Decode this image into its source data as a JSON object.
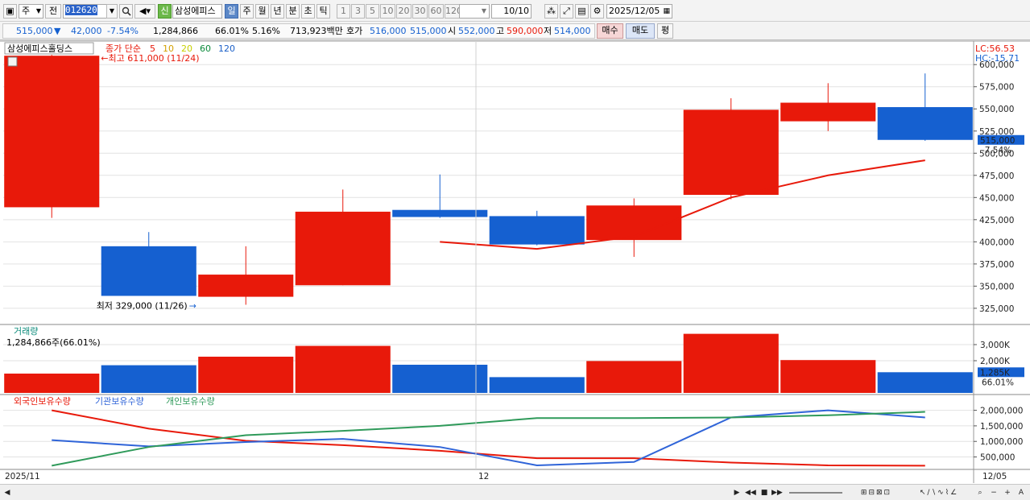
{
  "toolbar": {
    "period_select": "주",
    "prev_label": "전",
    "stock_code": "012620",
    "new_label": "신",
    "stock_name": "삼성에피스",
    "tf_tabs": [
      "일",
      "주",
      "월",
      "년",
      "분",
      "초",
      "틱"
    ],
    "tf_selected": "일",
    "intervals": [
      "1",
      "3",
      "5",
      "10",
      "20",
      "30",
      "60",
      "120"
    ],
    "count": "10",
    "count_total": "/10",
    "date": "2025/12/05"
  },
  "quote": {
    "price": "515,000",
    "change_arrow": "▼",
    "change": "42,000",
    "change_rate": "-7.54%",
    "volume": "1,284,866",
    "vol_ratio": "66.01%",
    "turnover": "5.16%",
    "amount": "713,923백만",
    "ask_label": "호가",
    "ask": "516,000",
    "bid": "515,000",
    "open_label": "시",
    "open": "552,000",
    "high_label": "고",
    "high": "590,000",
    "low_label": "저",
    "low": "514,000",
    "buy_label": "매수",
    "sell_label": "매도",
    "eval_label": "평"
  },
  "colors": {
    "up": "#e8190a",
    "down": "#1560d0",
    "ma5": "#e8190a",
    "ma10": "#d4a000",
    "ma20": "#c8d000",
    "ma60": "#0a8a3a",
    "ma120": "#1a5fc8",
    "foreign": "#e8190a",
    "inst": "#2f64d8",
    "indiv": "#2f9a5a"
  },
  "chart_data": {
    "type": "candlestick",
    "stock": "삼성에피스홀딩스",
    "legend": "종가 단순",
    "ma_periods": [
      "5",
      "10",
      "20",
      "60",
      "120"
    ],
    "lc_label": "LC:56.53",
    "hc_label": "HC:-15.71",
    "high_mark": "최고 611,000 (11/24)",
    "low_mark": "최저 329,000 (11/26)",
    "last_price_label": "515,000",
    "last_change_label": "-7.54%",
    "price_ticks": [
      "600,000",
      "575,000",
      "550,000",
      "525,000",
      "500,000",
      "475,000",
      "450,000",
      "425,000",
      "400,000",
      "375,000",
      "350,000",
      "325,000"
    ],
    "price_tick_values": [
      600000,
      575000,
      550000,
      525000,
      500000,
      475000,
      450000,
      425000,
      400000,
      375000,
      350000,
      325000
    ],
    "price_range": [
      314000,
      612000
    ],
    "candles": [
      {
        "o": 439000,
        "h": 611000,
        "l": 427000,
        "c": 610000
      },
      {
        "o": 395000,
        "h": 411000,
        "l": 339000,
        "c": 339000
      },
      {
        "o": 338000,
        "h": 395000,
        "l": 329000,
        "c": 363000
      },
      {
        "o": 351000,
        "h": 459000,
        "l": 351000,
        "c": 434000
      },
      {
        "o": 436000,
        "h": 476000,
        "l": 427000,
        "c": 428000
      },
      {
        "o": 429000,
        "h": 435000,
        "l": 396000,
        "c": 397000
      },
      {
        "o": 402000,
        "h": 449000,
        "l": 383000,
        "c": 441000
      },
      {
        "o": 453000,
        "h": 562000,
        "l": 448000,
        "c": 549000
      },
      {
        "o": 536000,
        "h": 579000,
        "l": 525000,
        "c": 557000
      },
      {
        "o": 552000,
        "h": 590000,
        "l": 514000,
        "c": 515000
      }
    ],
    "ma5": [
      null,
      null,
      null,
      null,
      400000,
      392000,
      406000,
      450000,
      475000,
      492000
    ],
    "volume_title": "거래량",
    "volume_label": "1,284,866주(66.01%)",
    "volume_ticks": [
      "3,000K",
      "2,000K"
    ],
    "volume_tick_values": [
      3000,
      2000
    ],
    "volume_range": [
      0,
      3800
    ],
    "volume_last_label": "1,285K",
    "volume_last_ratio": "66.01%",
    "volume": [
      1200,
      1720,
      2250,
      2920,
      1750,
      980,
      1980,
      3670,
      2040,
      1285
    ],
    "holdings_legend": [
      "외국인보유수량",
      "기관보유수량",
      "개인보유수량"
    ],
    "holdings_ticks": [
      "2,000,000",
      "1,500,000",
      "1,000,000",
      "500,000"
    ],
    "holdings_tick_values": [
      2000000,
      1500000,
      1000000,
      500000
    ],
    "holdings_range": [
      100000,
      2300000
    ],
    "foreign": [
      2000000,
      1410000,
      1020000,
      880000,
      700000,
      460000,
      460000,
      320000,
      230000,
      220000
    ],
    "inst": [
      1040000,
      840000,
      980000,
      1080000,
      820000,
      230000,
      340000,
      1770000,
      2000000,
      1770000
    ],
    "indiv": [
      220000,
      820000,
      1200000,
      1340000,
      1500000,
      1750000,
      1750000,
      1770000,
      1840000,
      1950000
    ],
    "x_start_label": "2025/11",
    "x_mid_label": "12",
    "x_end_label": "12/05"
  }
}
